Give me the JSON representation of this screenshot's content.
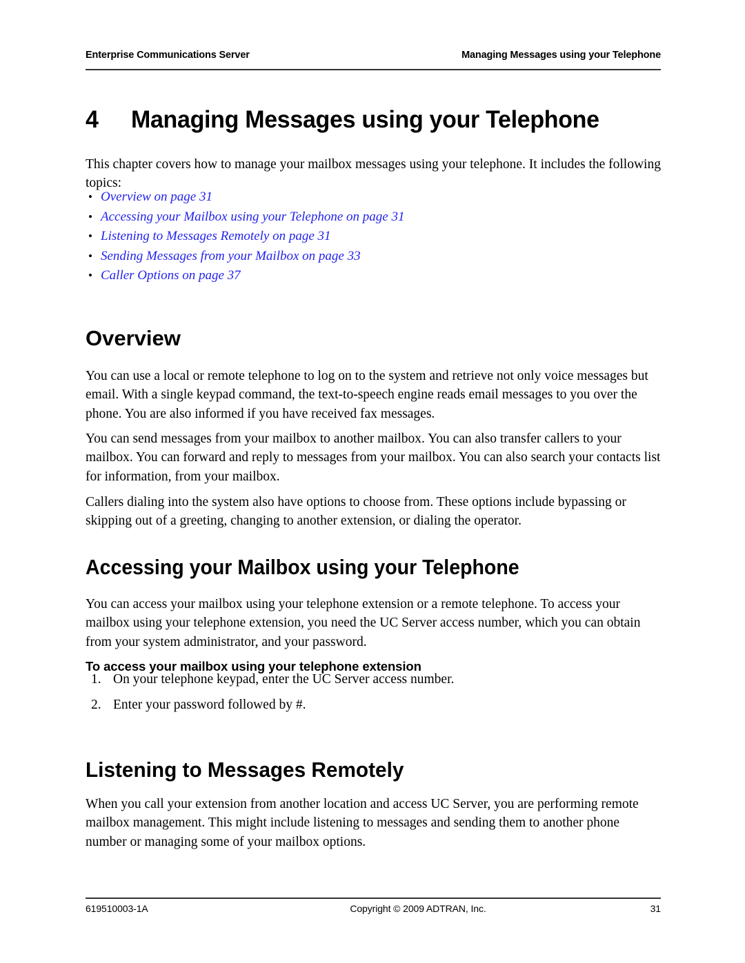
{
  "header": {
    "left": "Enterprise Communications Server",
    "right": "Managing Messages using your Telephone"
  },
  "chapter": {
    "number": "4",
    "title": "Managing Messages using your Telephone"
  },
  "intro": {
    "paragraph": "This chapter covers how to manage your mailbox messages using your telephone. It includes the following topics:"
  },
  "topics": [
    {
      "label": "Overview on page 31"
    },
    {
      "label": "Accessing your Mailbox using your Telephone on page 31"
    },
    {
      "label": "Listening to Messages Remotely on page 31"
    },
    {
      "label": "Sending Messages from your Mailbox on page 33"
    },
    {
      "label": "Caller Options on page 37"
    }
  ],
  "sections": {
    "overview": {
      "heading": "Overview",
      "paragraphs": [
        "You can use a local or remote telephone to log on to the system and retrieve not only voice messages but email. With a single keypad command, the text-to-speech engine reads email messages to you over the phone. You are also informed if you have received fax messages.",
        "You can send messages from your mailbox to another mailbox. You can also transfer callers to your mailbox. You can forward and reply to messages from your mailbox. You can also search your contacts list for information, from your mailbox.",
        "Callers dialing into the system also have options to choose from. These options include bypassing or skipping out of a greeting, changing to another extension, or dialing the operator."
      ]
    },
    "accessing": {
      "heading": "Accessing your Mailbox using your Telephone",
      "paragraph": "You can access your mailbox using your telephone extension or a remote telephone. To access your mailbox using your telephone extension, you need the UC Server access number, which you can obtain from your system administrator, and your password.",
      "procedure_heading": "To access your mailbox using your telephone extension",
      "steps": [
        {
          "num": "1.",
          "text": "On your telephone keypad, enter the UC Server access number."
        },
        {
          "num": "2.",
          "text": "Enter your password followed by #."
        }
      ]
    },
    "listening": {
      "heading": "Listening to Messages Remotely",
      "paragraph": "When you call your extension from another location and access UC Server, you are performing remote mailbox management. This might include listening to messages and sending them to another phone number or managing some of your mailbox options."
    }
  },
  "footer": {
    "doc_number": "619510003-1A",
    "copyright": "Copyright © 2009 ADTRAN, Inc.",
    "page_number": "31"
  },
  "colors": {
    "link": "#2222ee",
    "rule": "#333333",
    "text": "#000000"
  }
}
